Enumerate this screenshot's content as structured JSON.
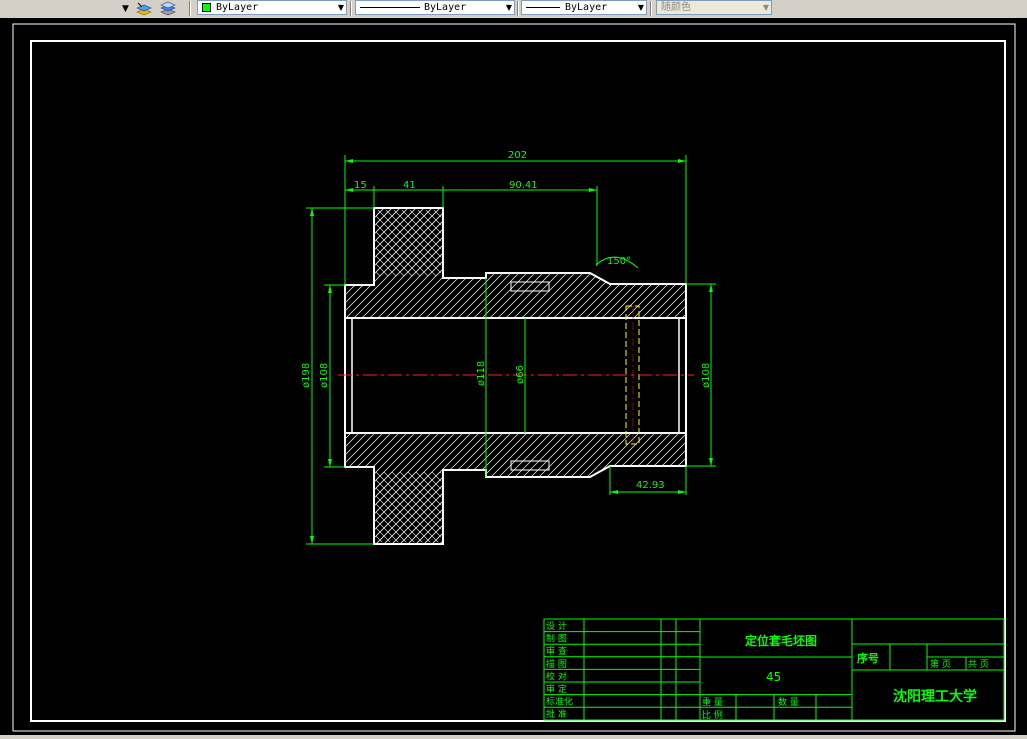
{
  "toolbar": {
    "color_combo": {
      "value": "ByLayer",
      "swatch_color": "#00ff00"
    },
    "linetype_combo": {
      "value": "ByLayer"
    },
    "lineweight_combo": {
      "value": "ByLayer"
    },
    "plotstyle_combo": {
      "value": "随颜色"
    }
  },
  "drawing": {
    "dimensions": {
      "overall_length": "202",
      "d15": "15",
      "d41": "41",
      "d9041": "90.41",
      "angle": "150°",
      "d4293": "42.93",
      "dia198": "ø198",
      "dia108_left": "ø108",
      "dia118": "ø118",
      "dia66": "ø66",
      "dia108_right": "ø108"
    },
    "title_block": {
      "left_labels": [
        "设 计",
        "制 图",
        "审 查",
        "描 图",
        "校 对",
        "审 定",
        "标准化",
        "批 准"
      ],
      "drawing_name": "定位套毛坯图",
      "material": "45",
      "weight_label": "重 量",
      "quantity_label": "数 量",
      "scale_label": "比 例",
      "seq_label": "序号",
      "page_label": "第 页",
      "total_label": "共 页",
      "school": "沈阳理工大学"
    }
  }
}
